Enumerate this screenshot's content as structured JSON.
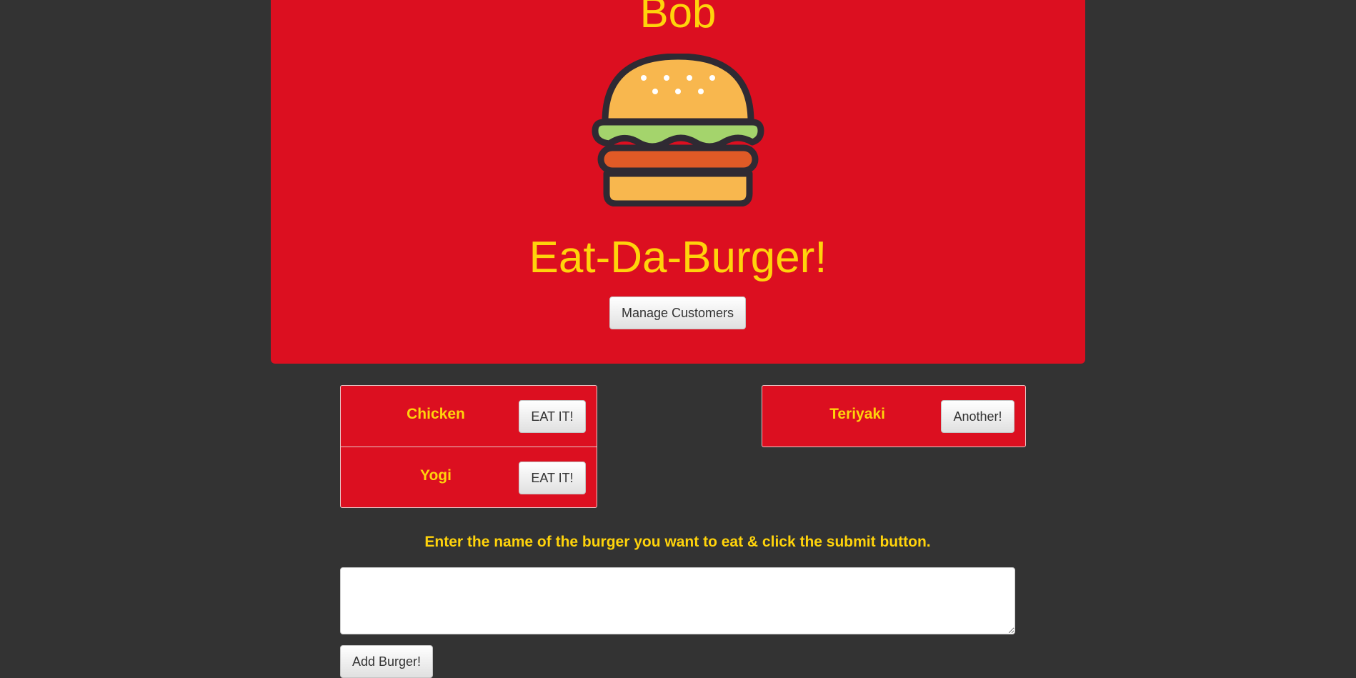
{
  "header": {
    "customer_name": "Bob",
    "title": "Eat-Da-Burger!",
    "manage_button_label": "Manage Customers",
    "logo_icon": "burger-icon"
  },
  "uneaten_burgers": [
    {
      "name": "Chicken",
      "button_label": "EAT IT!"
    },
    {
      "name": "Yogi",
      "button_label": "EAT IT!"
    }
  ],
  "eaten_burgers": [
    {
      "name": "Teriyaki",
      "button_label": "Another!"
    }
  ],
  "form": {
    "instructions": "Enter the name of the burger you want to eat & click the submit button.",
    "input_value": "",
    "submit_label": "Add Burger!"
  },
  "colors": {
    "background": "#333333",
    "panel": "#dc0f20",
    "accent_text": "#ffd30b"
  }
}
